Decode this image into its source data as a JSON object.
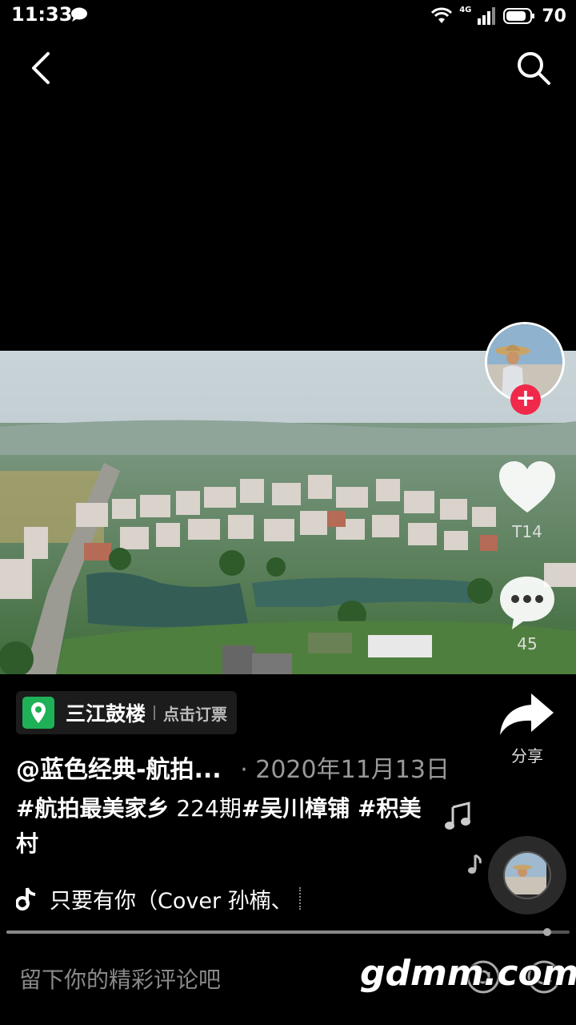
{
  "status": {
    "time": "11:33",
    "network": "4G",
    "battery": "70"
  },
  "video": {
    "author_avatar": "avatar",
    "likes": "T14",
    "comments": "45",
    "share_label": "分享"
  },
  "poi": {
    "name": "三江鼓楼",
    "action": "点击订票"
  },
  "post": {
    "author": "@蓝色经典-航拍...",
    "date": "· 2020年11月13日",
    "caption_tag1": "#航拍最美家乡",
    "caption_mid": " 224期",
    "caption_tag2": "#吴川樟铺 #积美村"
  },
  "music": {
    "title": "只要有你（Cover 孙楠、"
  },
  "playback": {
    "progress": 0.96
  },
  "comment": {
    "placeholder": "留下你的精彩评论吧"
  },
  "watermark": "gdmm.com",
  "icons": [
    "back-icon",
    "search-icon",
    "heart-icon",
    "comment-icon",
    "share-icon",
    "location-pin-icon",
    "music-note-icon",
    "at-icon",
    "emoji-icon"
  ]
}
